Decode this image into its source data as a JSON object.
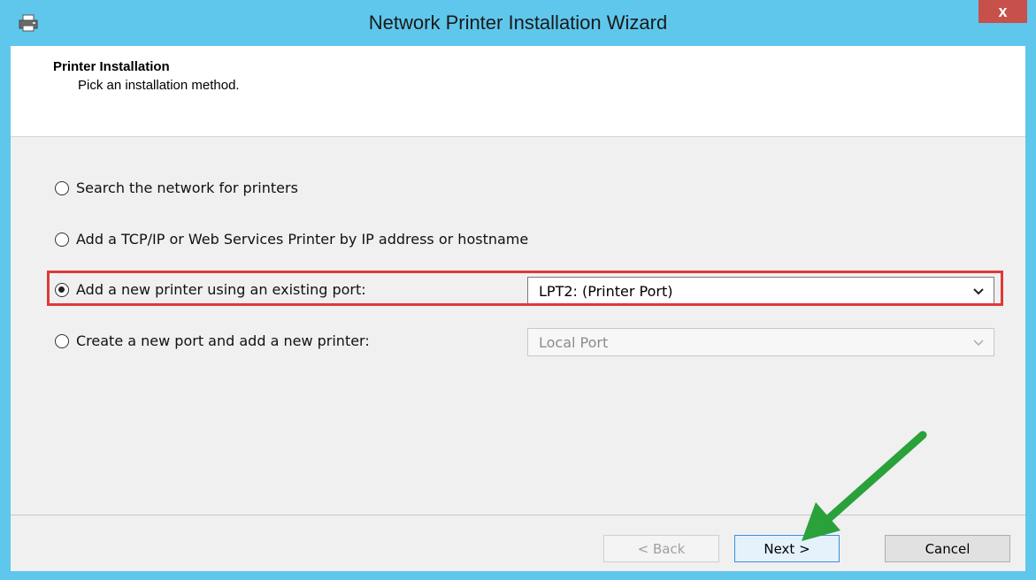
{
  "window": {
    "title": "Network Printer Installation Wizard",
    "close_glyph": "x"
  },
  "header": {
    "title": "Printer Installation",
    "subtitle": "Pick an installation method."
  },
  "options": [
    {
      "label": "Search the network for printers",
      "checked": false
    },
    {
      "label": "Add a TCP/IP or Web Services Printer by IP address or hostname",
      "checked": false
    },
    {
      "label": "Add a new printer using an existing port:",
      "checked": true
    },
    {
      "label": "Create a new port and add a new printer:",
      "checked": false
    }
  ],
  "existing_port_select": {
    "value": "LPT2: (Printer Port)",
    "enabled": true
  },
  "new_port_select": {
    "value": "Local Port",
    "enabled": false
  },
  "buttons": {
    "back": "< Back",
    "next": "Next >",
    "cancel": "Cancel"
  },
  "colors": {
    "titlebar": "#5fc7ec",
    "close_button": "#c7504b",
    "highlight_box": "#e0393a",
    "annotation_arrow": "#2aa13a"
  },
  "icons": {
    "app": "printer-icon",
    "close": "close-icon",
    "dropdown": "chevron-down-icon",
    "annotation": "green-arrow-icon"
  }
}
